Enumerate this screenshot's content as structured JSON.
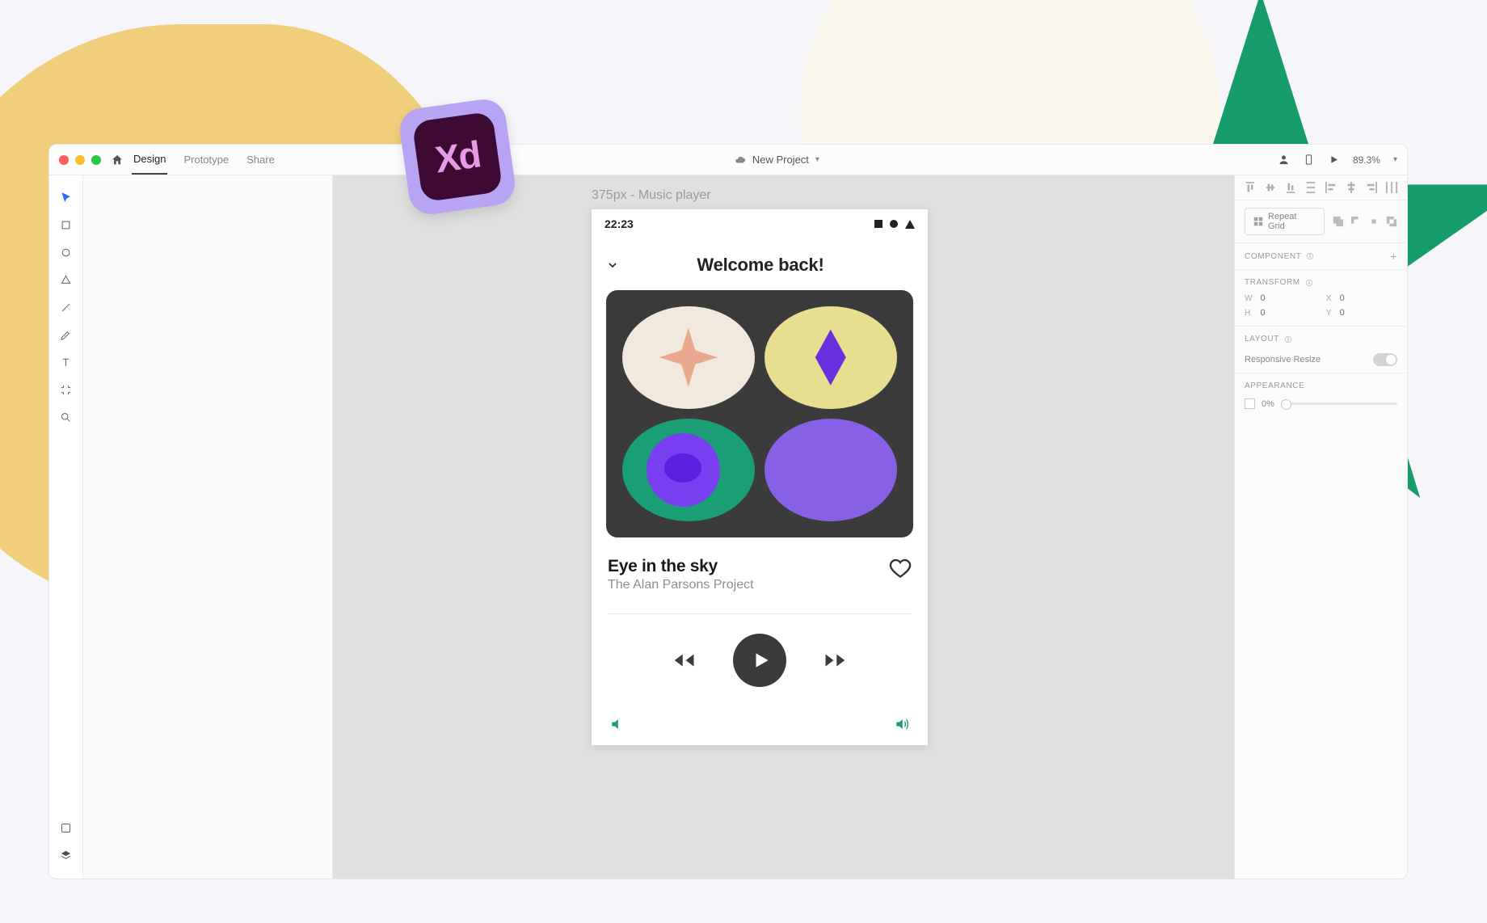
{
  "nav": {
    "design": "Design",
    "prototype": "Prototype",
    "share": "Share"
  },
  "titlebar": {
    "project": "New Project",
    "zoom": "89.3%"
  },
  "canvas": {
    "artboard_label": "375px - Music player"
  },
  "artboard": {
    "clock": "22:23",
    "header": "Welcome back!",
    "track_title": "Eye in the sky",
    "track_artist": "The Alan Parsons Project"
  },
  "inspector": {
    "repeat_grid": "Repeat Grid",
    "component": "COMPONENT",
    "transform": "TRANSFORM",
    "w_label": "W",
    "w_val": "0",
    "x_label": "X",
    "x_val": "0",
    "h_label": "H",
    "h_val": "0",
    "y_label": "Y",
    "y_val": "0",
    "layout": "LAYOUT",
    "responsive": "Responsive Resize",
    "appearance": "APPEARANCE",
    "opacity": "0%"
  },
  "badge": {
    "text": "Xd"
  }
}
